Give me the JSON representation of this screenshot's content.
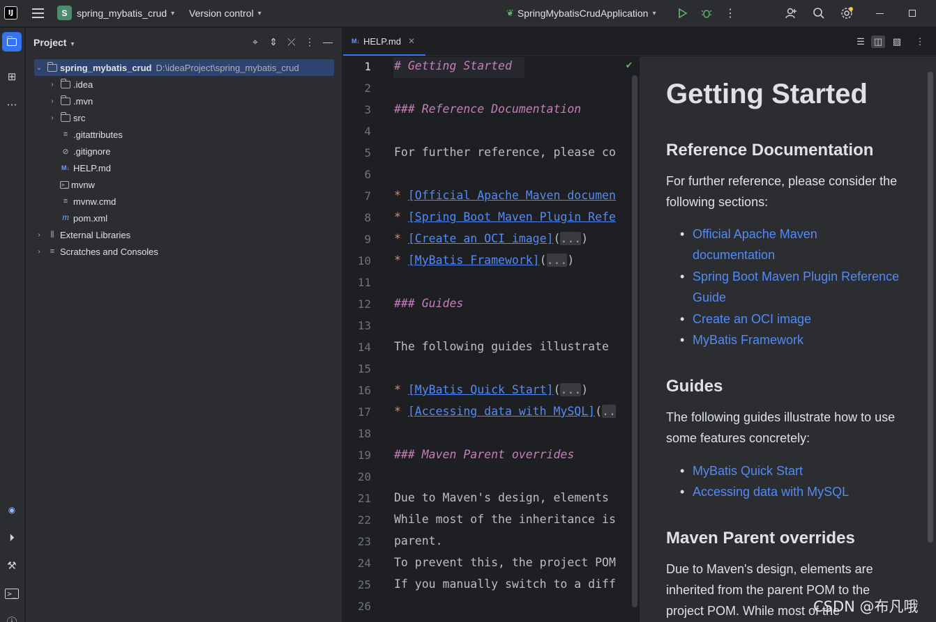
{
  "titlebar": {
    "logo": "IJ",
    "project_badge": "S",
    "project_name": "spring_mybatis_crud",
    "vcs": "Version control",
    "run_config": "SpringMybatisCrudApplication"
  },
  "project_panel": {
    "title": "Project",
    "root_name": "spring_mybatis_crud",
    "root_path": "D:\\ideaProject\\spring_mybatis_crud",
    "items": [
      {
        "label": ".idea"
      },
      {
        "label": ".mvn"
      },
      {
        "label": "src"
      },
      {
        "label": ".gitattributes"
      },
      {
        "label": ".gitignore"
      },
      {
        "label": "HELP.md"
      },
      {
        "label": "mvnw"
      },
      {
        "label": "mvnw.cmd"
      },
      {
        "label": "pom.xml"
      }
    ],
    "external_libraries": "External Libraries",
    "scratches": "Scratches and Consoles"
  },
  "editor": {
    "tab_label": "HELP.md",
    "tab_icon": "M↓",
    "lines": {
      "l1": "# Getting Started",
      "l3": "### Reference Documentation",
      "l5": "For further reference, please co",
      "l7_link": "[Official Apache Maven documen",
      "l8_link": "[Spring Boot Maven Plugin Refe",
      "l9_link": "[Create an OCI image]",
      "l10_link": "[MyBatis Framework]",
      "l12": "### Guides",
      "l14": "The following guides illustrate",
      "l16_link": "[MyBatis Quick Start]",
      "l17_link": "[Accessing data with MySQL]",
      "l19": "### Maven Parent overrides",
      "l21": "Due to Maven's design, elements",
      "l22": "While most of the inheritance is",
      "l23": "parent.",
      "l24": "To prevent this, the project POM",
      "l25": "If you manually switch to a diff",
      "star": "*",
      "dots": "...",
      "dots_short": ".."
    }
  },
  "preview": {
    "h1": "Getting Started",
    "h_ref": "Reference Documentation",
    "p_ref": "For further reference, please consider the following sections:",
    "ref_links": [
      "Official Apache Maven documentation",
      "Spring Boot Maven Plugin Reference Guide",
      "Create an OCI image",
      "MyBatis Framework"
    ],
    "h_guides": "Guides",
    "p_guides": "The following guides illustrate how to use some features concretely:",
    "guide_links": [
      "MyBatis Quick Start",
      "Accessing data with MySQL"
    ],
    "h_maven": "Maven Parent overrides",
    "p_maven": "Due to Maven's design, elements are inherited from the parent POM to the project POM. While most of the"
  },
  "watermark": "CSDN @布凡哦"
}
